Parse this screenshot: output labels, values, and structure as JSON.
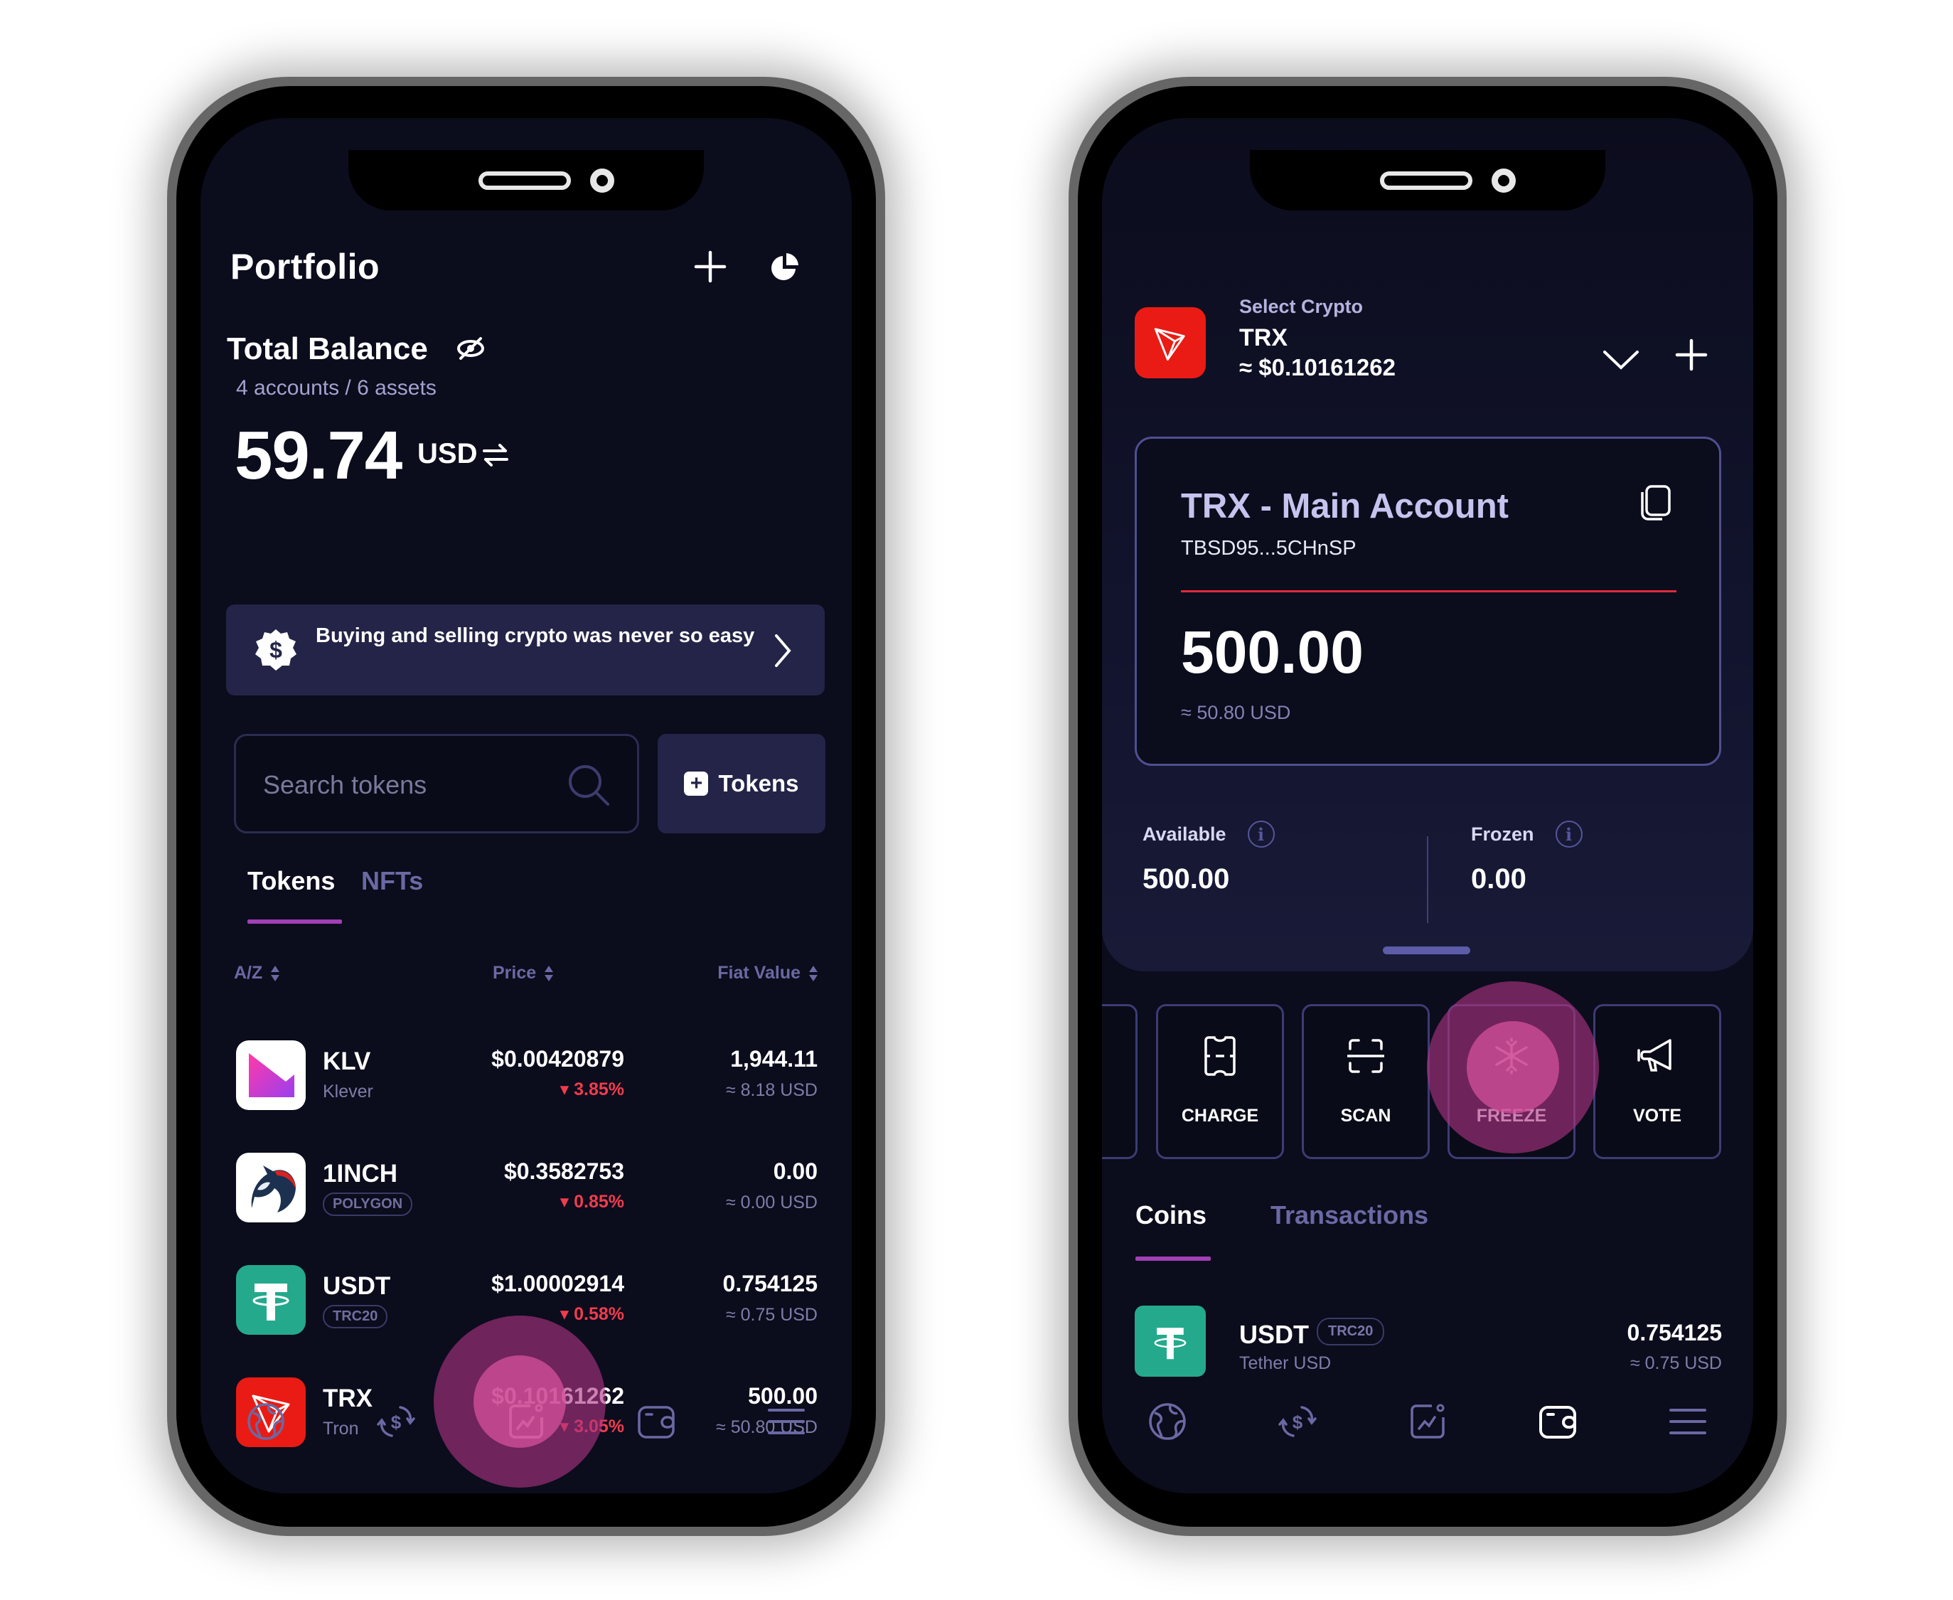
{
  "left_phone": {
    "header": {
      "title": "Portfolio",
      "add_icon": "plus-icon",
      "chart_icon": "pie-chart-icon"
    },
    "balance": {
      "title": "Total Balance",
      "hide_icon": "eye-slash-icon",
      "subtitle": "4 accounts / 6 assets",
      "amount": "59.74",
      "currency": "USD",
      "swap_icon": "swap-arrows-icon"
    },
    "promo": {
      "text": "Buying and selling crypto was never so easy",
      "icon": "dollar-badge-icon",
      "arrow_icon": "chevron-right-icon"
    },
    "search": {
      "placeholder": "Search tokens",
      "value": ""
    },
    "add_tokens_label": "Tokens",
    "tabs": [
      {
        "label": "Tokens",
        "active": true
      },
      {
        "label": "NFTs",
        "active": false
      }
    ],
    "columns": {
      "name": "A/Z",
      "price": "Price",
      "fiat": "Fiat Value"
    },
    "tokens": [
      {
        "symbol": "KLV",
        "name": "Klever",
        "badge": null,
        "price": "$0.00420879",
        "change": "▾ 3.85%",
        "amount": "1,944.11",
        "fiat": "≈ 8.18 USD",
        "logo": "klever-logo"
      },
      {
        "symbol": "1INCH",
        "name": null,
        "badge": "POLYGON",
        "price": "$0.3582753",
        "change": "▾ 0.85%",
        "amount": "0.00",
        "fiat": "≈ 0.00 USD",
        "logo": "1inch-logo"
      },
      {
        "symbol": "USDT",
        "name": null,
        "badge": "TRC20",
        "price": "$1.00002914",
        "change": "▾ 0.58%",
        "amount": "0.754125",
        "fiat": "≈ 0.75 USD",
        "logo": "tether-logo"
      },
      {
        "symbol": "TRX",
        "name": "Tron",
        "badge": null,
        "price": "$0.10161262",
        "change": "▾ 3.05%",
        "amount": "500.00",
        "fiat": "≈ 50.80 USD",
        "logo": "tron-logo"
      }
    ],
    "nav": [
      {
        "icon": "globe-icon",
        "active": false
      },
      {
        "icon": "exchange-dollar-icon",
        "active": false
      },
      {
        "icon": "portfolio-chart-icon",
        "active": true
      },
      {
        "icon": "wallet-icon",
        "active": false
      },
      {
        "icon": "menu-icon",
        "active": false
      }
    ]
  },
  "right_phone": {
    "selector": {
      "label": "Select Crypto",
      "symbol": "TRX",
      "price": "≈ $0.10161262",
      "dropdown_icon": "chevron-down-icon",
      "add_icon": "plus-icon"
    },
    "account": {
      "title": "TRX - Main Account",
      "address": "TBSD95...5CHnSP",
      "balance": "500.00",
      "fiat": "≈ 50.80 USD",
      "copy_icon": "copy-icon"
    },
    "available": {
      "label": "Available",
      "value": "500.00"
    },
    "frozen": {
      "label": "Frozen",
      "value": "0.00"
    },
    "actions": [
      {
        "label": "CHARGE",
        "icon": "ticket-icon"
      },
      {
        "label": "SCAN",
        "icon": "scan-icon"
      },
      {
        "label": "FREEZE",
        "icon": "snowflake-icon"
      },
      {
        "label": "VOTE",
        "icon": "megaphone-icon"
      }
    ],
    "tabs": [
      {
        "label": "Coins",
        "active": true
      },
      {
        "label": "Transactions",
        "active": false
      }
    ],
    "coins": [
      {
        "symbol": "USDT",
        "badge": "TRC20",
        "name": "Tether USD",
        "amount": "0.754125",
        "fiat": "≈ 0.75 USD"
      }
    ],
    "nav": [
      {
        "icon": "globe-icon",
        "active": false
      },
      {
        "icon": "exchange-dollar-icon",
        "active": false
      },
      {
        "icon": "portfolio-chart-icon",
        "active": false
      },
      {
        "icon": "wallet-icon",
        "active": true
      },
      {
        "icon": "menu-icon",
        "active": false
      }
    ]
  },
  "colors": {
    "background": "#0b0c1c",
    "card": "#232447",
    "accent_underline": "#a13fb6",
    "negative": "#f23b4e",
    "tron_red": "#ea1b14",
    "tether_green": "#25a98c",
    "muted_text": "#7e7da8",
    "tap_indicator": "#c84c8e"
  }
}
